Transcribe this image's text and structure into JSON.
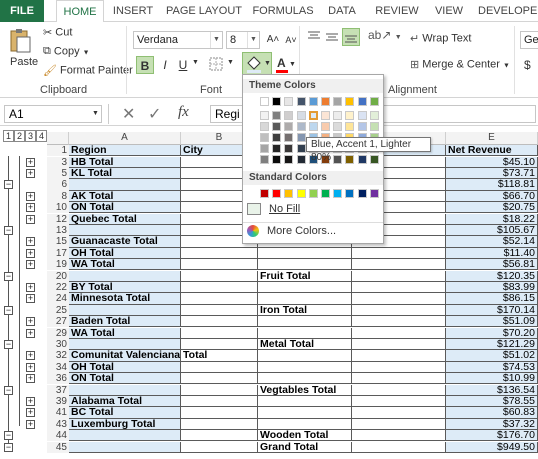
{
  "tabs": [
    "FILE",
    "HOME",
    "INSERT",
    "PAGE LAYOUT",
    "FORMULAS",
    "DATA",
    "REVIEW",
    "VIEW",
    "DEVELOPER"
  ],
  "clipboard": {
    "cut": "Cut",
    "copy": "Copy",
    "paste": "Paste",
    "format_painter": "Format Painter",
    "label": "Clipboard"
  },
  "font": {
    "name": "Verdana",
    "size": "8",
    "label": "Font",
    "bold": "B",
    "italic": "I",
    "underline": "U",
    "grow": "A˄",
    "shrink": "A˅"
  },
  "alignment": {
    "wrap_text": "Wrap Text",
    "merge_center": "Merge & Center",
    "label": "Alignment"
  },
  "number": {
    "format": "Ge",
    "currency": "$"
  },
  "formula_bar": {
    "name_box": "A1",
    "formula": "Regi",
    "fx": "fx"
  },
  "outline_levels": [
    "1",
    "2",
    "3",
    "4"
  ],
  "columns": [
    "A",
    "B",
    "E"
  ],
  "color_picker": {
    "theme_title": "Theme Colors",
    "standard_title": "Standard Colors",
    "no_fill": "No Fill",
    "more_colors": "More Colors...",
    "tooltip": "Blue, Accent 1, Lighter 80%",
    "theme_top": [
      "#FFFFFF",
      "#000000",
      "#E7E6E6",
      "#44546A",
      "#5B9BD5",
      "#ED7D31",
      "#A5A5A5",
      "#FFC000",
      "#4472C4",
      "#70AD47"
    ],
    "theme_shades": [
      [
        "#F2F2F2",
        "#7F7F7F",
        "#D0CECE",
        "#D6DCE4",
        "#DEEBF6",
        "#FBE5D5",
        "#EDEDED",
        "#FFF2CC",
        "#DAE3F3",
        "#E2EFD9"
      ],
      [
        "#D8D8D8",
        "#595959",
        "#AEABAB",
        "#ADB9CA",
        "#BDD7EE",
        "#F8CBAD",
        "#DBDBDB",
        "#FEE599",
        "#B4C6E7",
        "#C5E0B3"
      ],
      [
        "#BFBFBF",
        "#3F3F3F",
        "#757070",
        "#8496B0",
        "#9CC3E5",
        "#F4B183",
        "#C9C9C9",
        "#FFD965",
        "#8EAADB",
        "#A8D08D"
      ],
      [
        "#A5A5A5",
        "#262626",
        "#3A3838",
        "#323F4F",
        "#2E75B5",
        "#C55A11",
        "#7B7B7B",
        "#BF9000",
        "#2F5496",
        "#538135"
      ],
      [
        "#7F7F7F",
        "#0C0C0C",
        "#171616",
        "#222A35",
        "#1E4E79",
        "#833C0B",
        "#525252",
        "#7F6000",
        "#1F3864",
        "#375623"
      ]
    ],
    "standard": [
      "#C00000",
      "#FF0000",
      "#FFC000",
      "#FFFF00",
      "#92D050",
      "#00B050",
      "#00B0F0",
      "#0070C0",
      "#002060",
      "#7030A0"
    ]
  },
  "header_row": {
    "region": "Region",
    "city": "City",
    "net_revenue": "Net Revenue"
  },
  "rows": [
    {
      "num": "3",
      "a": "HB Total",
      "c": "",
      "e": "$45.10",
      "pm": "+"
    },
    {
      "num": "5",
      "a": "KL Total",
      "c": "",
      "e": "$73.71",
      "pm": "+"
    },
    {
      "num": "6",
      "a": "",
      "c": "",
      "e": "$118.81",
      "pm": "−"
    },
    {
      "num": "8",
      "a": "AK Total",
      "c": "",
      "e": "$66.70",
      "pm": "+"
    },
    {
      "num": "10",
      "a": "ON Total",
      "c": "",
      "e": "$20.75",
      "pm": "+"
    },
    {
      "num": "12",
      "a": "Quebec Total",
      "c": "",
      "e": "$18.22",
      "pm": "+"
    },
    {
      "num": "13",
      "a": "",
      "c": "",
      "e": "$105.67",
      "pm": "−"
    },
    {
      "num": "15",
      "a": "Guanacaste Total",
      "c": "",
      "e": "$52.14",
      "pm": "+"
    },
    {
      "num": "17",
      "a": "OH Total",
      "c": "",
      "e": "$11.40",
      "pm": "+"
    },
    {
      "num": "19",
      "a": "WA Total",
      "c": "",
      "e": "$56.81",
      "pm": "+"
    },
    {
      "num": "20",
      "a": "",
      "c": "Fruit Total",
      "e": "$120.35",
      "pm": "−"
    },
    {
      "num": "22",
      "a": "BY Total",
      "c": "",
      "e": "$83.99",
      "pm": "+"
    },
    {
      "num": "24",
      "a": "Minnesota Total",
      "c": "",
      "e": "$86.15",
      "pm": "+"
    },
    {
      "num": "25",
      "a": "",
      "c": "Iron Total",
      "e": "$170.14",
      "pm": "−"
    },
    {
      "num": "27",
      "a": "Baden Total",
      "c": "",
      "e": "$51.09",
      "pm": "+"
    },
    {
      "num": "29",
      "a": "WA Total",
      "c": "",
      "e": "$70.20",
      "pm": "+"
    },
    {
      "num": "30",
      "a": "",
      "c": "Metal Total",
      "e": "$121.29",
      "pm": "−"
    },
    {
      "num": "32",
      "a": "Comunitat Valenciana Total",
      "c": "",
      "e": "$51.02",
      "pm": "+"
    },
    {
      "num": "34",
      "a": "OH Total",
      "c": "",
      "e": "$74.53",
      "pm": "+"
    },
    {
      "num": "36",
      "a": "ON Total",
      "c": "",
      "e": "$10.99",
      "pm": "+"
    },
    {
      "num": "37",
      "a": "",
      "c": "Vegtables Total",
      "e": "$136.54",
      "pm": "−"
    },
    {
      "num": "39",
      "a": "Alabama Total",
      "c": "",
      "e": "$78.55",
      "pm": "+"
    },
    {
      "num": "41",
      "a": "BC Total",
      "c": "",
      "e": "$60.83",
      "pm": "+"
    },
    {
      "num": "43",
      "a": "Luxemburg Total",
      "c": "",
      "e": "$37.32",
      "pm": "+"
    },
    {
      "num": "44",
      "a": "",
      "c": "Wooden Total",
      "e": "$176.70",
      "pm": "−"
    },
    {
      "num": "45",
      "a": "",
      "c": "Grand Total",
      "e": "$949.50",
      "pm": "−"
    }
  ],
  "colors": {
    "excel_green": "#217346",
    "header_fill": "#DDEBF7"
  }
}
